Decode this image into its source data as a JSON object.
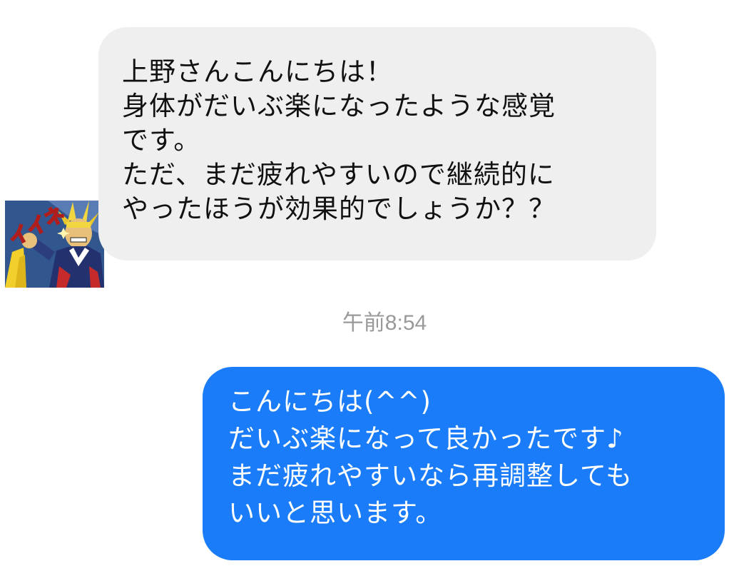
{
  "conversation": {
    "incoming": {
      "avatar_icon": "all-might-iine-sticker-icon",
      "avatar_text": "イイネ",
      "lines": [
        "上野さんこんにちは！",
        "身体がだいぶ楽になったような感覚",
        "です。",
        "ただ、まだ疲れやすいので継続的に",
        "やったほうが効果的でしょうか？？"
      ],
      "bubble_color": "#efefef"
    },
    "timestamp": "午前8:54",
    "outgoing": {
      "lines": [
        "こんにちは(^^)",
        "だいぶ楽になって良かったです♪",
        "まだ疲れやすいなら再調整しても",
        "いいと思います。"
      ],
      "bubble_color": "#1a7cf8"
    }
  }
}
